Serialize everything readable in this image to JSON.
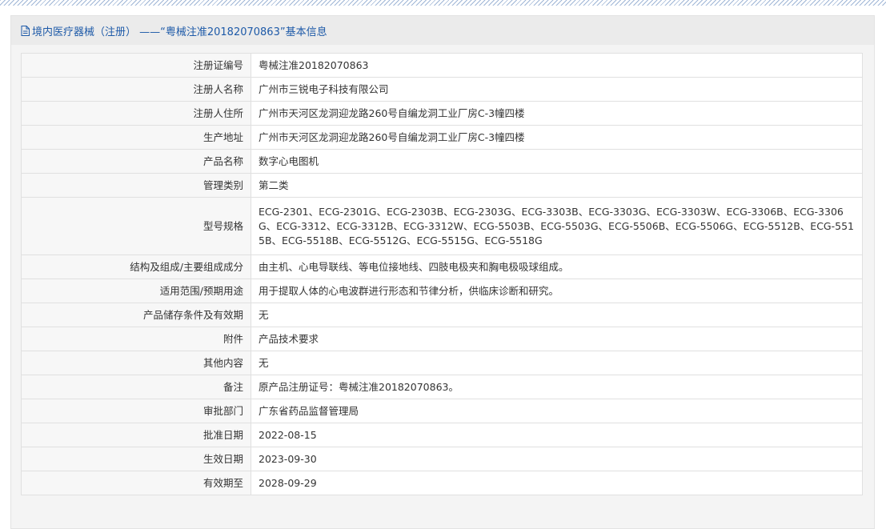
{
  "header": {
    "title": "境内医疗器械（注册） ——“粤械注准20182070863”基本信息",
    "icon": "document-icon",
    "color": "#1e5aa8"
  },
  "rows": [
    {
      "label": "注册证编号",
      "value": "粤械注准20182070863"
    },
    {
      "label": "注册人名称",
      "value": "广州市三锐电子科技有限公司"
    },
    {
      "label": "注册人住所",
      "value": "广州市天河区龙洞迎龙路260号自编龙洞工业厂房C-3幢四楼"
    },
    {
      "label": "生产地址",
      "value": "广州市天河区龙洞迎龙路260号自编龙洞工业厂房C-3幢四楼"
    },
    {
      "label": "产品名称",
      "value": "数字心电图机"
    },
    {
      "label": "管理类别",
      "value": "第二类"
    },
    {
      "label": "型号规格",
      "value": "ECG-2301、ECG-2301G、ECG-2303B、ECG-2303G、ECG-3303B、ECG-3303G、ECG-3303W、ECG-3306B、ECG-3306G、ECG-3312、ECG-3312B、ECG-3312W、ECG-5503B、ECG-5503G、ECG-5506B、ECG-5506G、ECG-5512B、ECG-5515B、ECG-5518B、ECG-5512G、ECG-5515G、ECG-5518G"
    },
    {
      "label": "结构及组成/主要组成成分",
      "value": "由主机、心电导联线、等电位接地线、四肢电极夹和胸电极吸球组成。"
    },
    {
      "label": "适用范围/预期用途",
      "value": "用于提取人体的心电波群进行形态和节律分析，供临床诊断和研究。"
    },
    {
      "label": "产品储存条件及有效期",
      "value": "无"
    },
    {
      "label": "附件",
      "value": "产品技术要求"
    },
    {
      "label": "其他内容",
      "value": "无"
    },
    {
      "label": "备注",
      "value": "原产品注册证号：粤械注准20182070863。"
    },
    {
      "label": "审批部门",
      "value": "广东省药品监督管理局"
    },
    {
      "label": "批准日期",
      "value": "2022-08-15"
    },
    {
      "label": "生效日期",
      "value": "2023-09-30"
    },
    {
      "label": "有效期至",
      "value": "2028-09-29"
    }
  ]
}
